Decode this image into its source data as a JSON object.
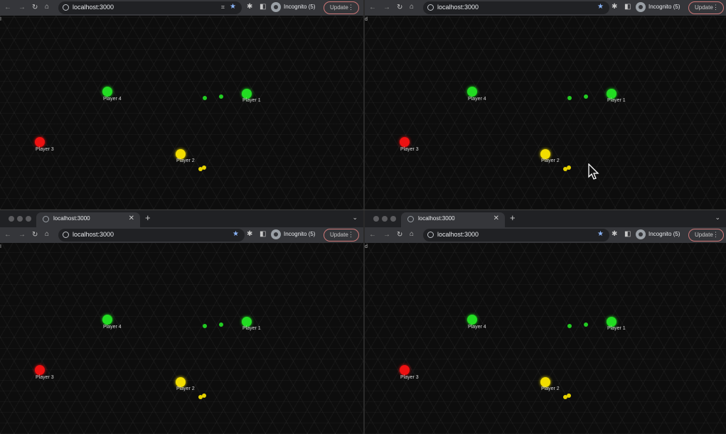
{
  "browser": {
    "tab_title": "localhost:3000",
    "url": "localhost:3000",
    "profile_label": "Incognito (5)",
    "update_label": "Update",
    "accent_star_color": "#8ab4f8",
    "icons": [
      "back-icon",
      "forward-icon",
      "reload-icon",
      "home-icon",
      "info-icon",
      "qr-code-icon",
      "star-icon",
      "extensions-icon",
      "side-panel-icon",
      "incognito-icon",
      "menu-dots-icon",
      "globe-icon",
      "close-icon",
      "plus-icon",
      "chevron-down-icon",
      "mouse-cursor-icon"
    ]
  },
  "panes": {
    "top_left": {
      "corner_letter": "I"
    },
    "top_right": {
      "corner_letter": "d"
    },
    "bottom_left": {
      "corner_letter": "I"
    },
    "bottom_right": {
      "corner_letter": "d"
    }
  },
  "game": {
    "players": [
      {
        "label": "Player 1",
        "color": "#22dd22"
      },
      {
        "label": "Player 2",
        "color": "#f2dd00"
      },
      {
        "label": "Player 3",
        "color": "#ee1111"
      },
      {
        "label": "Player 4",
        "color": "#22dd22"
      }
    ],
    "food_color_green": "#22cc22",
    "food_color_yellow": "#e6d200"
  }
}
